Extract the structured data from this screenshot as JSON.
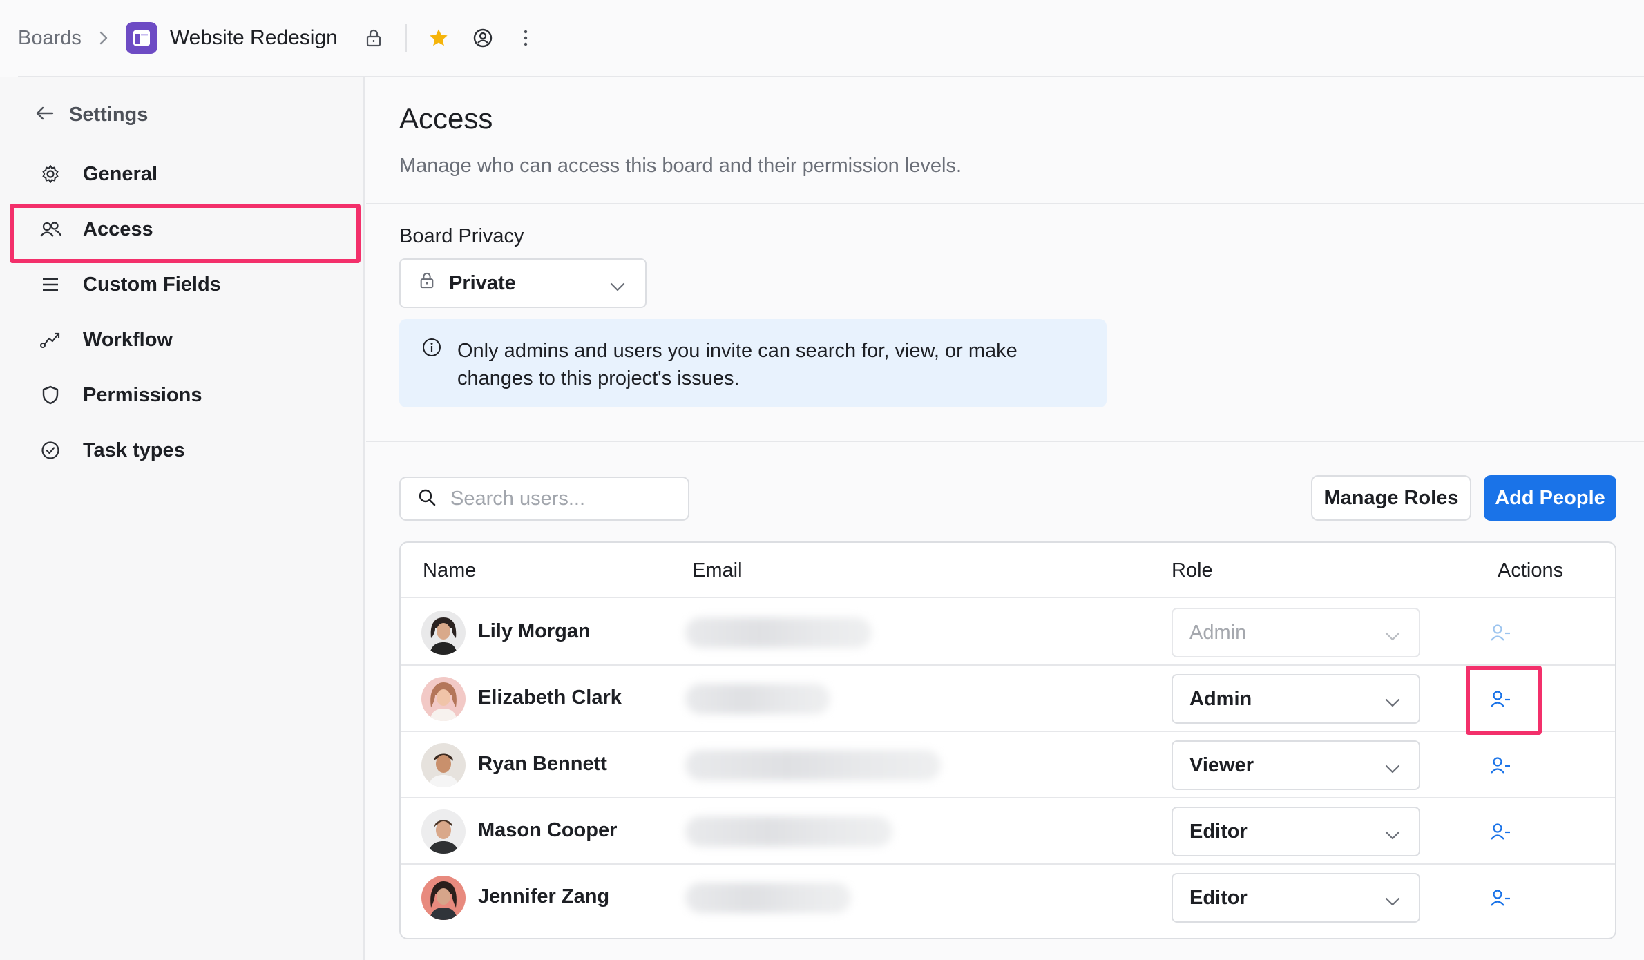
{
  "topbar": {
    "breadcrumb_root": "Boards",
    "board_title": "Website Redesign",
    "icons": [
      "chevron-right-icon",
      "board-icon",
      "lock-icon",
      "star-icon",
      "watch-icon",
      "more-vertical-icon"
    ],
    "star_color": "#f5b40a"
  },
  "sidebar": {
    "back_label": "Settings",
    "items": [
      {
        "label": "General",
        "icon": "gear-icon"
      },
      {
        "label": "Access",
        "icon": "users-icon",
        "active": true
      },
      {
        "label": "Custom Fields",
        "icon": "list-icon"
      },
      {
        "label": "Workflow",
        "icon": "workflow-icon"
      },
      {
        "label": "Permissions",
        "icon": "shield-icon"
      },
      {
        "label": "Task types",
        "icon": "check-circle-icon"
      }
    ]
  },
  "main": {
    "title": "Access",
    "subtitle": "Manage who can access this board and their permission levels.",
    "privacy_label": "Board Privacy",
    "privacy_value": "Private",
    "info_text": "Only admins and users you invite can search for, view, or make changes to this project's issues.",
    "search_placeholder": "Search users...",
    "manage_roles_label": "Manage Roles",
    "add_people_label": "Add People",
    "accent_color": "#1a73e8",
    "highlight_color": "#f3306b"
  },
  "table": {
    "headers": {
      "name": "Name",
      "email": "Email",
      "role": "Role",
      "actions": "Actions"
    },
    "rows": [
      {
        "name": "Lily Morgan",
        "role": "Admin",
        "role_disabled": true
      },
      {
        "name": "Elizabeth Clark",
        "role": "Admin",
        "highlighted": true
      },
      {
        "name": "Ryan Bennett",
        "role": "Viewer"
      },
      {
        "name": "Mason Cooper",
        "role": "Editor"
      },
      {
        "name": "Jennifer Zang",
        "role": "Editor"
      }
    ]
  }
}
